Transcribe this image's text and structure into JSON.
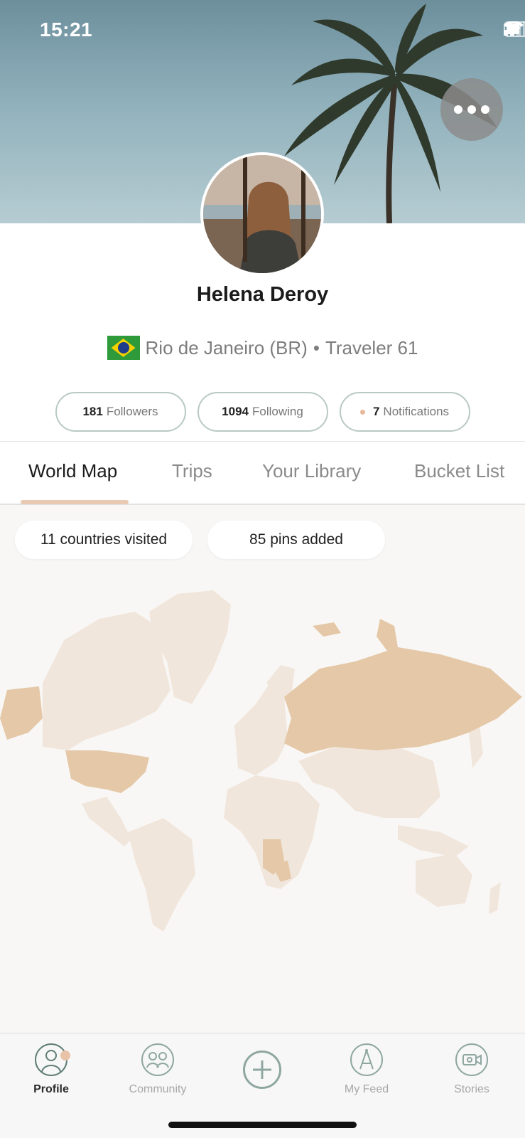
{
  "status_bar": {
    "time": "15:21"
  },
  "profile": {
    "name": "Helena Deroy",
    "location": "Rio de Janeiro (BR)",
    "separator": "•",
    "rank": "Traveler 61",
    "flag_icon": "brazil-flag-icon"
  },
  "stats": [
    {
      "count": "181",
      "label": "Followers"
    },
    {
      "count": "1094",
      "label": "Following"
    },
    {
      "count": "7",
      "label": "Notifications"
    }
  ],
  "tabs": [
    {
      "label": "World Map",
      "active": true
    },
    {
      "label": "Trips",
      "active": false
    },
    {
      "label": "Your Library",
      "active": false
    },
    {
      "label": "Bucket List",
      "active": false
    }
  ],
  "map": {
    "countries_chip": "11 countries visited",
    "pins_chip": "85 pins added",
    "visited_color": "#e4c8a7",
    "unvisited_color": "#f1e6dc"
  },
  "bottom_nav": [
    {
      "label": "Profile",
      "icon": "profile-icon",
      "active": true
    },
    {
      "label": "Community",
      "icon": "community-icon",
      "active": false
    },
    {
      "label": "",
      "icon": "add-icon",
      "active": false
    },
    {
      "label": "My Feed",
      "icon": "compass-icon",
      "active": false
    },
    {
      "label": "Stories",
      "icon": "camera-icon",
      "active": false
    }
  ]
}
